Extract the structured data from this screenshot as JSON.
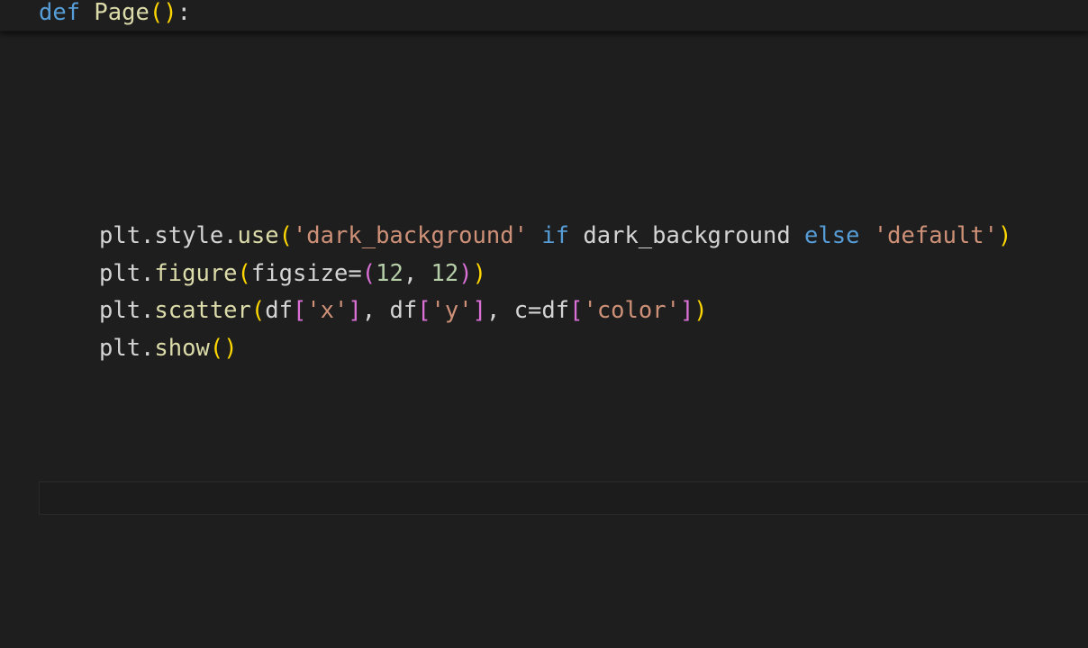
{
  "header": {
    "def_kw": "def",
    "func_name": "Page",
    "open": "(",
    "close": ")",
    "colon": ":"
  },
  "code": {
    "line1": {
      "obj": "plt.style.",
      "method": "use",
      "open": "(",
      "str1": "'dark_background'",
      "sp1": " ",
      "kw_if": "if",
      "var": " dark_background ",
      "kw_else": "else",
      "sp2": " ",
      "str2": "'default'",
      "close": ")"
    },
    "line2": {
      "obj": "plt.",
      "method": "figure",
      "open": "(",
      "arg": "figsize=",
      "open2": "(",
      "num1": "12",
      "comma": ", ",
      "num2": "12",
      "close2": ")",
      "close": ")"
    },
    "line3": {
      "obj": "plt.",
      "method": "scatter",
      "open": "(",
      "df1": "df",
      "b1o": "[",
      "s1": "'x'",
      "b1c": "]",
      "comma1": ", ",
      "df2": "df",
      "b2o": "[",
      "s2": "'y'",
      "b2c": "]",
      "comma2": ", ",
      "arg": "c=df",
      "b3o": "[",
      "s3": "'color'",
      "b3c": "]",
      "close": ")"
    },
    "line4": {
      "obj": "plt.",
      "method": "show",
      "open": "(",
      "close": ")"
    }
  },
  "colors": {
    "background": "#1e1e1e",
    "keyword": "#569cd6",
    "function": "#dcdcaa",
    "string": "#ce9178",
    "number": "#b5cea8",
    "bracket_gold": "#ffd700",
    "bracket_violet": "#da70d6"
  }
}
